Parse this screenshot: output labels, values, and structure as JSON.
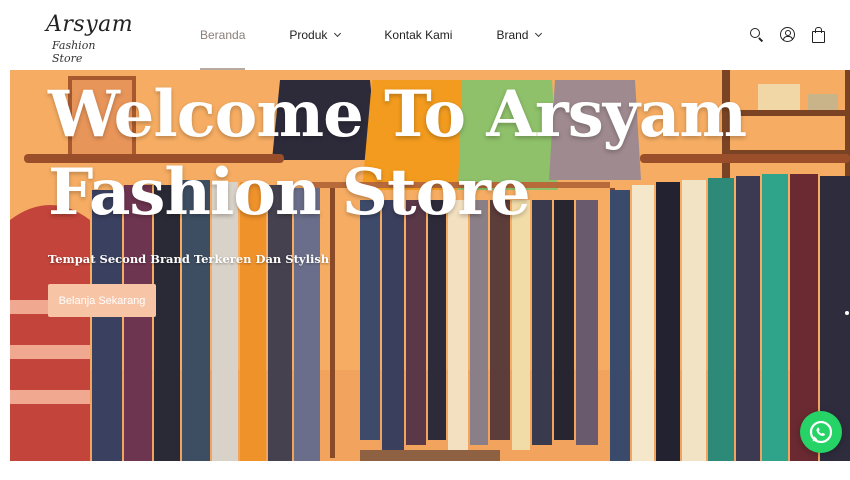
{
  "logo": {
    "main": "Arsyam",
    "sub": "Fashion Store"
  },
  "nav": {
    "items": [
      {
        "label": "Beranda",
        "active": true,
        "dropdown": false
      },
      {
        "label": "Produk",
        "active": false,
        "dropdown": true
      },
      {
        "label": "Kontak Kami",
        "active": false,
        "dropdown": false
      },
      {
        "label": "Brand",
        "active": false,
        "dropdown": true
      }
    ]
  },
  "header_icons": [
    "search-icon",
    "user-icon",
    "shopping-bag-icon"
  ],
  "hero": {
    "title_line1": "Welcome To Arsyam",
    "title_line2": "Fashion Store",
    "subtitle": "Tempat Second Brand Terkeren Dan Stylish",
    "cta_label": "Belanja Sekarang"
  },
  "floating": {
    "icon": "whatsapp-icon"
  },
  "colors": {
    "active_nav": "#8a7f78",
    "cta_bg": "#f8c4a6",
    "whatsapp": "#25d366",
    "hero_bg": "#f4a75d"
  }
}
